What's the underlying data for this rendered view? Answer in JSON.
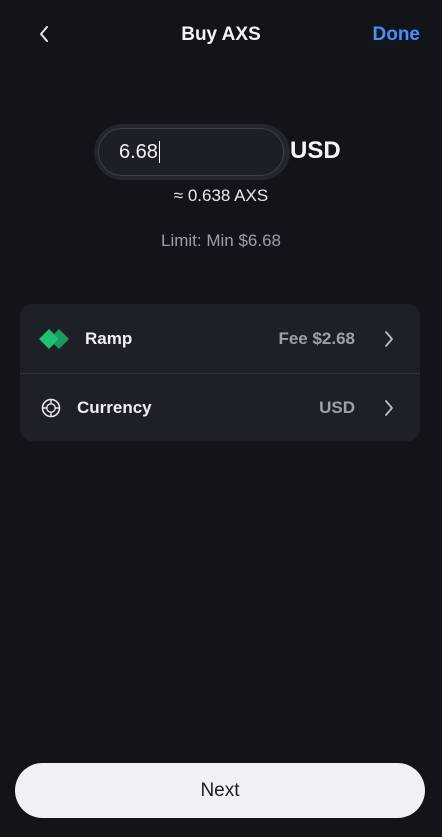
{
  "header": {
    "title": "Buy AXS",
    "done_label": "Done"
  },
  "amount": {
    "value": "6.68",
    "currency": "USD"
  },
  "conversion_text": "≈ 0.638 AXS",
  "limit_text": "Limit: Min $6.68",
  "options": {
    "provider": {
      "label": "Ramp",
      "value": "Fee $2.68",
      "icon": "ramp-logo-icon",
      "icon_color": "#21bf73"
    },
    "currency": {
      "label": "Currency",
      "value": "USD",
      "icon": "globe-icon"
    }
  },
  "footer": {
    "next_label": "Next"
  },
  "colors": {
    "background": "#121419",
    "accent": "#4b8dfa",
    "card": "#1d2026"
  }
}
